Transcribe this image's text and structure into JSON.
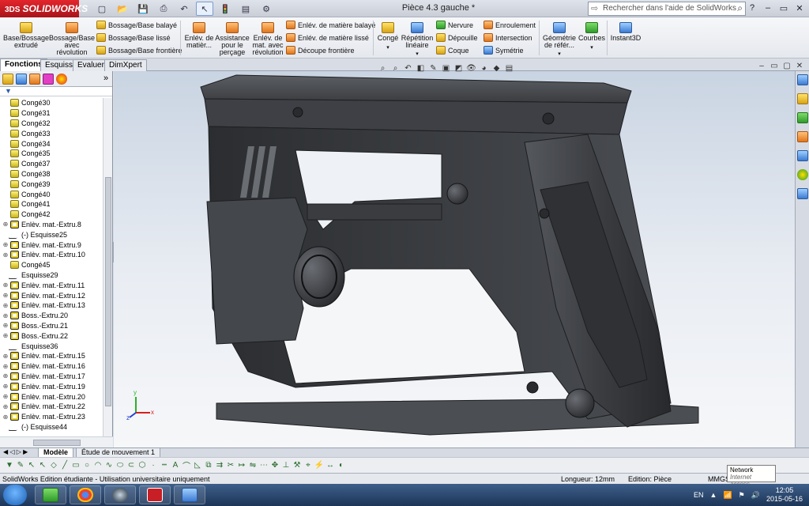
{
  "titlebar": {
    "app_name": "SOLIDWORKS",
    "brand_mark": "3DS",
    "document_title": "Pièce 4.3 gauche *",
    "help_search_placeholder": "Rechercher dans l'aide de SolidWorks",
    "quick_access": [
      "new-icon",
      "open-icon",
      "save-icon",
      "print-icon",
      "undo-icon",
      "select-icon",
      "rebuild-icon",
      "file-properties-icon",
      "options-icon"
    ],
    "window_controls": [
      "?",
      "–",
      "▭",
      "✕"
    ]
  },
  "ribbon": {
    "large_buttons": [
      {
        "label": "Base/Bossage extrudé",
        "icon": "extruded-boss-icon"
      },
      {
        "label": "Bossage/Base avec révolution",
        "icon": "revolved-boss-icon"
      },
      {
        "label": "Enlév. de matièr...",
        "icon": "extruded-cut-icon"
      },
      {
        "label": "Assistance pour le perçage",
        "icon": "hole-wizard-icon"
      },
      {
        "label": "Enlév. de mat. avec révolution",
        "icon": "revolved-cut-icon"
      },
      {
        "label": "Congé",
        "icon": "fillet-icon"
      },
      {
        "label": "Répétition linéaire",
        "icon": "linear-pattern-icon"
      },
      {
        "label": "Géométrie de référ...",
        "icon": "reference-geometry-icon"
      },
      {
        "label": "Courbes",
        "icon": "curves-icon"
      },
      {
        "label": "Instant3D",
        "icon": "instant3d-icon"
      }
    ],
    "boss_small": [
      "Bossage/Base balayé",
      "Bossage/Base lissé",
      "Bossage/Base frontière"
    ],
    "cut_small": [
      "Enlév. de matière balayé",
      "Enlév. de matière lissé",
      "Découpe frontière"
    ],
    "feature_small_a": [
      "Nervure",
      "Dépouille",
      "Coque"
    ],
    "feature_small_b": [
      "Enroulement",
      "Intersection",
      "Symétrie"
    ]
  },
  "tabs": [
    "Fonctions",
    "Esquisse",
    "Evaluer",
    "DimXpert"
  ],
  "active_tab": "Fonctions",
  "feature_tree": [
    {
      "label": "Congé30",
      "type": "fillet"
    },
    {
      "label": "Congé31",
      "type": "fillet"
    },
    {
      "label": "Congé32",
      "type": "fillet"
    },
    {
      "label": "Congé33",
      "type": "fillet"
    },
    {
      "label": "Congé34",
      "type": "fillet"
    },
    {
      "label": "Congé35",
      "type": "fillet"
    },
    {
      "label": "Congé37",
      "type": "fillet"
    },
    {
      "label": "Congé38",
      "type": "fillet"
    },
    {
      "label": "Congé39",
      "type": "fillet"
    },
    {
      "label": "Congé40",
      "type": "fillet"
    },
    {
      "label": "Congé41",
      "type": "fillet"
    },
    {
      "label": "Congé42",
      "type": "fillet"
    },
    {
      "label": "Enlèv. mat.-Extru.8",
      "type": "extrude",
      "expandable": true
    },
    {
      "label": "(-) Esquisse25",
      "type": "sketch"
    },
    {
      "label": "Enlèv. mat.-Extru.9",
      "type": "extrude",
      "expandable": true
    },
    {
      "label": "Enlèv. mat.-Extru.10",
      "type": "extrude",
      "expandable": true
    },
    {
      "label": "Congé45",
      "type": "fillet"
    },
    {
      "label": "Esquisse29",
      "type": "sketch"
    },
    {
      "label": "Enlèv. mat.-Extru.11",
      "type": "extrude",
      "expandable": true
    },
    {
      "label": "Enlèv. mat.-Extru.12",
      "type": "extrude",
      "expandable": true
    },
    {
      "label": "Enlèv. mat.-Extru.13",
      "type": "extrude",
      "expandable": true
    },
    {
      "label": "Boss.-Extru.20",
      "type": "extrude",
      "expandable": true
    },
    {
      "label": "Boss.-Extru.21",
      "type": "extrude",
      "expandable": true
    },
    {
      "label": "Boss.-Extru.22",
      "type": "extrude",
      "expandable": true
    },
    {
      "label": "Esquisse36",
      "type": "sketch"
    },
    {
      "label": "Enlèv. mat.-Extru.15",
      "type": "extrude",
      "expandable": true
    },
    {
      "label": "Enlèv. mat.-Extru.16",
      "type": "extrude",
      "expandable": true
    },
    {
      "label": "Enlèv. mat.-Extru.17",
      "type": "extrude",
      "expandable": true
    },
    {
      "label": "Enlèv. mat.-Extru.19",
      "type": "extrude",
      "expandable": true
    },
    {
      "label": "Enlèv. mat.-Extru.20",
      "type": "extrude",
      "expandable": true
    },
    {
      "label": "Enlèv. mat.-Extru.22",
      "type": "extrude",
      "expandable": true
    },
    {
      "label": "Enlèv. mat.-Extru.23",
      "type": "extrude",
      "expandable": true
    },
    {
      "label": "(-) Esquisse44",
      "type": "sketch"
    }
  ],
  "bottom_tabs": [
    "Modèle",
    "Étude de mouvement 1"
  ],
  "active_bottom_tab": "Modèle",
  "status": {
    "left": "SolidWorks Edition étudiante - Utilisation universitaire uniquement",
    "length": "Longueur: 12mm",
    "mode": "Edition: Pièce",
    "units": "MMGS"
  },
  "tooltip": {
    "title": "Network",
    "subtitle": "Internet access"
  },
  "taskbar": {
    "apps": [
      "file-explorer-icon",
      "chrome-icon",
      "steam-icon",
      "solidworks-icon",
      "remote-desktop-icon"
    ],
    "language": "EN",
    "time": "12:05",
    "date": "2015-05-16"
  },
  "triad": {
    "x": "x",
    "y": "y",
    "z": "z"
  },
  "colors": {
    "accent_red": "#c81e25",
    "model_gray": "#3d3f43",
    "viewport_top": "#c9d4e2"
  }
}
